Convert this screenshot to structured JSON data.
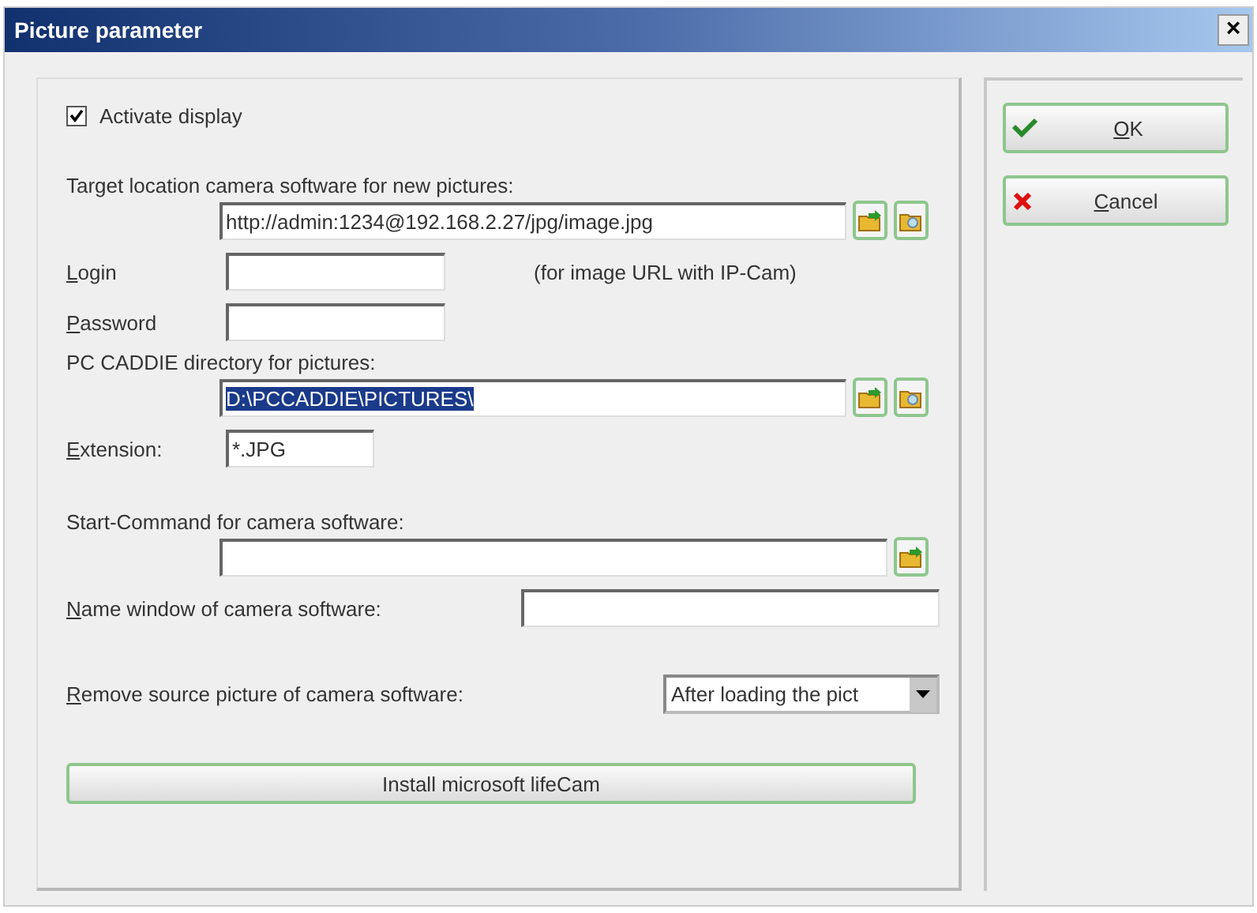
{
  "window": {
    "title": "Picture parameter",
    "close": "×"
  },
  "activate": {
    "label": "Activate display",
    "checked": true
  },
  "target": {
    "label": "Target location camera software for new pictures:",
    "value": "http://admin:1234@192.168.2.27/jpg/image.jpg"
  },
  "login": {
    "label": "Login",
    "accelerator": true,
    "note": "(for image URL with IP-Cam)"
  },
  "password": {
    "label": "Password",
    "accelerator": true
  },
  "directory": {
    "label": "PC CADDIE directory for pictures:",
    "value": "D:\\PCCADDIE\\PICTURES\\",
    "selected": true
  },
  "extension": {
    "label": "Extension:",
    "accelerator": true,
    "value": "*.JPG"
  },
  "start_command": {
    "label": "Start-Command for camera software:"
  },
  "name_window": {
    "label": "Name window of camera software:",
    "accelerator": true
  },
  "remove_source": {
    "label": "Remove source picture of camera software:",
    "accelerator": true,
    "value": "After loading the pict"
  },
  "install_button": "Install microsoft lifeCam",
  "buttons": [
    {
      "kind": "ok",
      "label": "OK"
    },
    {
      "kind": "cancel",
      "label": "Cancel"
    }
  ]
}
